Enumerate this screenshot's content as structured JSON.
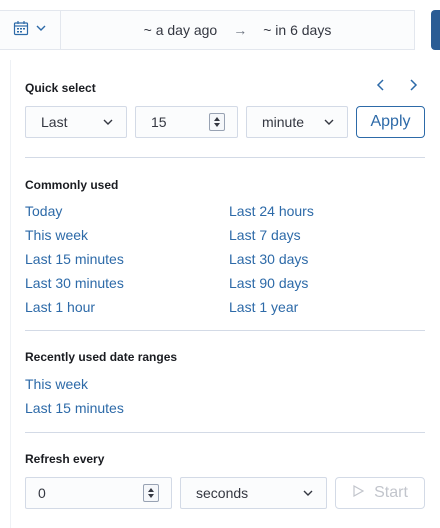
{
  "header": {
    "start_date": "~ a day ago",
    "arrow": "→",
    "end_date": "~ in 6 days"
  },
  "quick_select": {
    "title": "Quick select",
    "direction": "Last",
    "value": "15",
    "unit": "minute",
    "apply_label": "Apply"
  },
  "commonly_used": {
    "title": "Commonly used",
    "col1": [
      "Today",
      "This week",
      "Last 15 minutes",
      "Last 30 minutes",
      "Last 1 hour"
    ],
    "col2": [
      "Last 24 hours",
      "Last 7 days",
      "Last 30 days",
      "Last 90 days",
      "Last 1 year"
    ]
  },
  "recent": {
    "title": "Recently used date ranges",
    "items": [
      "This week",
      "Last 15 minutes"
    ]
  },
  "refresh": {
    "title": "Refresh every",
    "value": "0",
    "unit": "seconds",
    "start_label": "Start"
  },
  "colors": {
    "link": "#2d6aa8",
    "border": "#d3dae6",
    "disabled": "#c2c5cc"
  }
}
